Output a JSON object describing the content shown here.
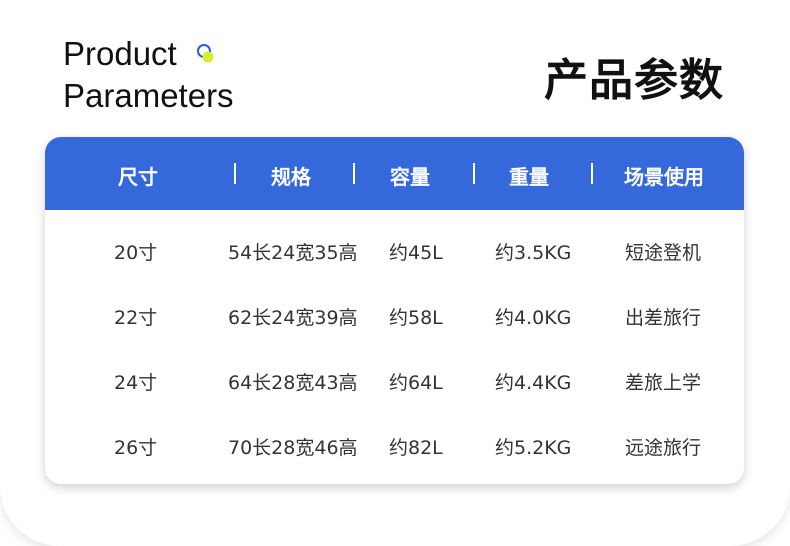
{
  "header": {
    "title_en_line1": "Product",
    "title_en_line2": "Parameters",
    "title_cn": "产品参数",
    "accent_ring_color": "#2a5cdf",
    "accent_dot_color": "#d4ee2f"
  },
  "table": {
    "header_color": "#3468db",
    "columns": [
      "尺寸",
      "规格",
      "容量",
      "重量",
      "场景使用"
    ],
    "rows": [
      [
        "20寸",
        "54长24宽35高",
        "约45L",
        "约3.5KG",
        "短途登机"
      ],
      [
        "22寸",
        "62长24宽39高",
        "约58L",
        "约4.0KG",
        "出差旅行"
      ],
      [
        "24寸",
        "64长28宽43高",
        "约64L",
        "约4.4KG",
        "差旅上学"
      ],
      [
        "26寸",
        "70长28宽46高",
        "约82L",
        "约5.2KG",
        "远途旅行"
      ]
    ]
  }
}
